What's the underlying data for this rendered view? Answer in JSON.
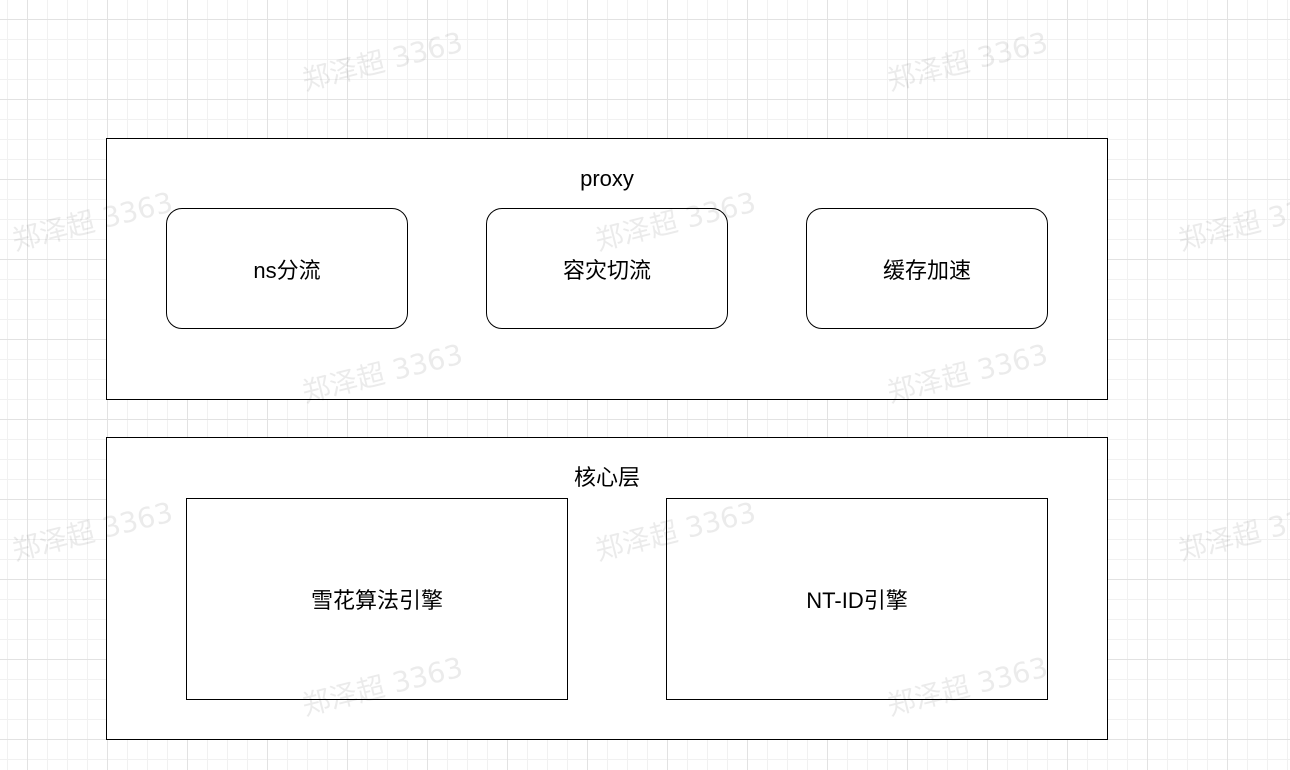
{
  "proxy_layer": {
    "title": "proxy",
    "nodes": [
      {
        "label": "ns分流"
      },
      {
        "label": "容灾切流"
      },
      {
        "label": "缓存加速"
      }
    ]
  },
  "core_layer": {
    "title": "核心层",
    "nodes": [
      {
        "label": "雪花算法引擎"
      },
      {
        "label": "NT-ID引擎"
      }
    ]
  },
  "watermark": {
    "text": "郑泽超 3363"
  },
  "colors": {
    "stroke": "#000000",
    "fill": "#ffffff",
    "grid": "#e2e2e2"
  }
}
